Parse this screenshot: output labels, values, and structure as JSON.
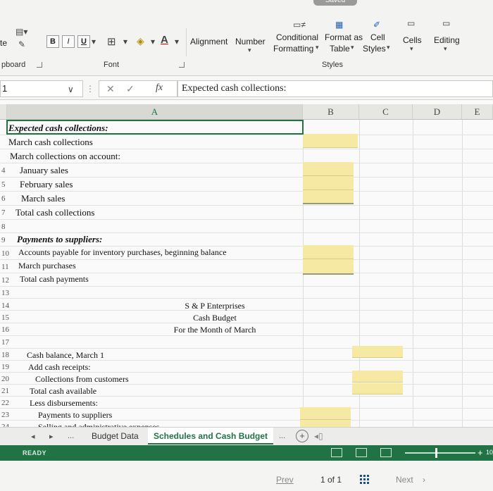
{
  "ribbon": {
    "saved_label": "Saved",
    "paste_label": "te",
    "font_buttons": [
      "B",
      "I",
      "U"
    ],
    "alignment_label": "Alignment",
    "number_label": "Number",
    "conditional_formatting_line1": "Conditional",
    "conditional_formatting_line2": "Formatting",
    "format_as_table_line1": "Format as",
    "format_as_table_line2": "Table",
    "cell_styles_line1": "Cell",
    "cell_styles_line2": "Styles",
    "cells_label": "Cells",
    "editing_label": "Editing",
    "clipboard_group": "pboard",
    "font_group": "Font",
    "styles_group": "Styles"
  },
  "formula_bar": {
    "name_box": "1",
    "fx": "fx",
    "formula": "Expected cash collections:"
  },
  "columns": [
    "A",
    "B",
    "C",
    "D",
    "E"
  ],
  "rows": [
    {
      "num": "",
      "text": "Expected cash collections:",
      "style": "bi"
    },
    {
      "num": "",
      "text": "March cash collections"
    },
    {
      "num": "",
      "text": "March collections on account:"
    },
    {
      "num": "4",
      "text": "January sales"
    },
    {
      "num": "5",
      "text": "February sales"
    },
    {
      "num": "6",
      "text": "March sales"
    },
    {
      "num": "7",
      "text": "Total cash collections"
    },
    {
      "num": "8",
      "text": ""
    },
    {
      "num": "9",
      "text": "Payments to suppliers:",
      "style": "bi"
    },
    {
      "num": "10",
      "text": "Accounts payable for inventory purchases, beginning balance"
    },
    {
      "num": "11",
      "text": "March purchases"
    },
    {
      "num": "12",
      "text": "Total cash payments"
    },
    {
      "num": "13",
      "text": ""
    },
    {
      "num": "14",
      "text": ""
    },
    {
      "num": "15",
      "text": ""
    },
    {
      "num": "16",
      "text": ""
    },
    {
      "num": "17",
      "text": ""
    },
    {
      "num": "18",
      "text": "Cash balance, March 1"
    },
    {
      "num": "19",
      "text": "Add cash receipts:"
    },
    {
      "num": "20",
      "text": "Collections from customers"
    },
    {
      "num": "21",
      "text": "Total cash available"
    },
    {
      "num": "22",
      "text": "Less disbursements:"
    },
    {
      "num": "23",
      "text": "Payments to suppliers"
    },
    {
      "num": "24",
      "text": "Selling and administrative expenses"
    }
  ],
  "budget_header": [
    "S & P Enterprises",
    "Cash Budget",
    "For the Month of March"
  ],
  "sheet_tabs": {
    "nav_prev": "◂",
    "nav_next": "▸",
    "more": "...",
    "tabs": [
      "Budget Data",
      "Schedules and Cash Budget"
    ],
    "more_right": "...",
    "add": "+"
  },
  "status_bar": {
    "ready": "READY",
    "zoom_plus": "+",
    "zoom_value": "10",
    "zoom_level": 0.45
  },
  "page_nav": {
    "prev": "Prev",
    "count": "1 of 1",
    "next": "Next"
  },
  "colors": {
    "accent": "#217346",
    "input_fill": "#f5e9a3"
  }
}
